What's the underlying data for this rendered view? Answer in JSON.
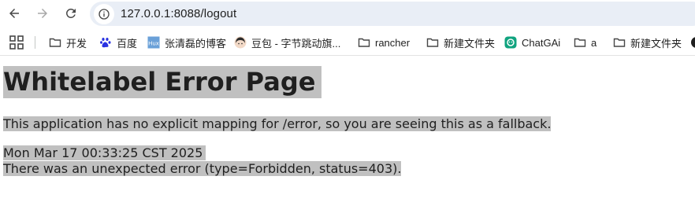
{
  "browser": {
    "url": "127.0.0.1:8088/logout"
  },
  "bookmarks": [
    {
      "label": "开发",
      "icon": "folder-icon"
    },
    {
      "label": "百度",
      "icon": "baidu-paw-icon"
    },
    {
      "label": "张清磊的博客",
      "icon": "blog-favicon"
    },
    {
      "label": "豆包 - 字节跳动旗...",
      "icon": "doubao-avatar-icon"
    },
    {
      "label": "rancher",
      "icon": "folder-icon"
    },
    {
      "label": "新建文件夹",
      "icon": "folder-icon"
    },
    {
      "label": "ChatGAi",
      "icon": "chatgai-icon"
    },
    {
      "label": "a",
      "icon": "folder-icon"
    },
    {
      "label": "新建文件夹",
      "icon": "folder-icon"
    }
  ],
  "page": {
    "heading": "Whitelabel Error Page",
    "message": "This application has no explicit mapping for /error, so you are seeing this as a fallback.",
    "timestamp": "Mon Mar 17 00:33:25 CST 2025",
    "error": "There was an unexpected error (type=Forbidden, status=403)."
  },
  "colors": {
    "highlight": "#c0c0c0",
    "omnibox": "#e9eef6"
  }
}
